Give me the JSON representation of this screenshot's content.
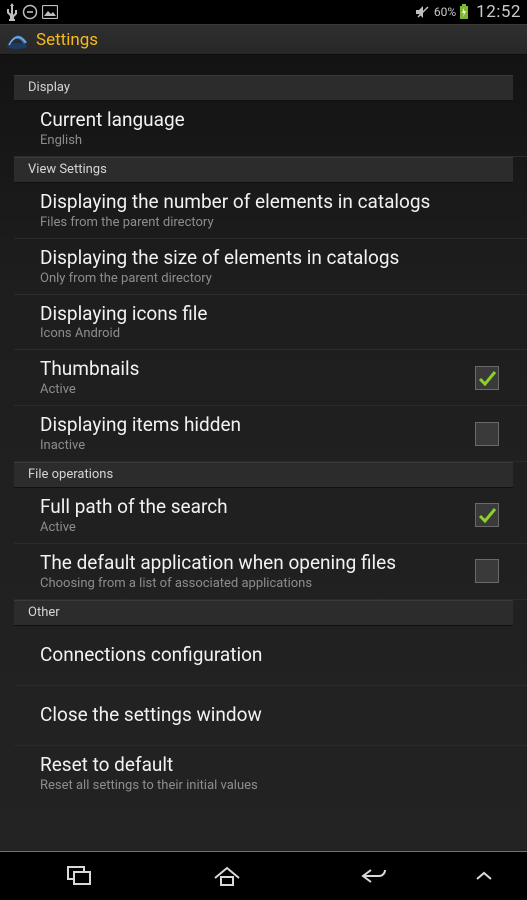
{
  "statusbar": {
    "battery_pct": "60%",
    "time": "12:52"
  },
  "titlebar": {
    "title": "Settings"
  },
  "sections": {
    "display": {
      "header": "Display"
    },
    "view": {
      "header": "View Settings"
    },
    "fileops": {
      "header": "File operations"
    },
    "other": {
      "header": "Other"
    }
  },
  "items": {
    "lang": {
      "title": "Current language",
      "sub": "English"
    },
    "num_elems": {
      "title": "Displaying the number of elements in catalogs",
      "sub": "Files from the parent directory"
    },
    "size_elems": {
      "title": "Displaying the size of elements in catalogs",
      "sub": "Only from the parent directory"
    },
    "icons_file": {
      "title": "Displaying icons file",
      "sub": "Icons Android"
    },
    "thumbnails": {
      "title": "Thumbnails",
      "sub": "Active",
      "checked": true
    },
    "hidden": {
      "title": "Displaying items hidden",
      "sub": "Inactive",
      "checked": false
    },
    "fullpath": {
      "title": "Full path of the search",
      "sub": "Active",
      "checked": true
    },
    "defaultapp": {
      "title": "The default application when opening files",
      "sub": "Choosing from a list of associated applications",
      "checked": false
    },
    "connections": {
      "title": "Connections configuration"
    },
    "close": {
      "title": "Close the settings window"
    },
    "reset": {
      "title": "Reset to default",
      "sub": "Reset all settings to their initial values"
    }
  }
}
